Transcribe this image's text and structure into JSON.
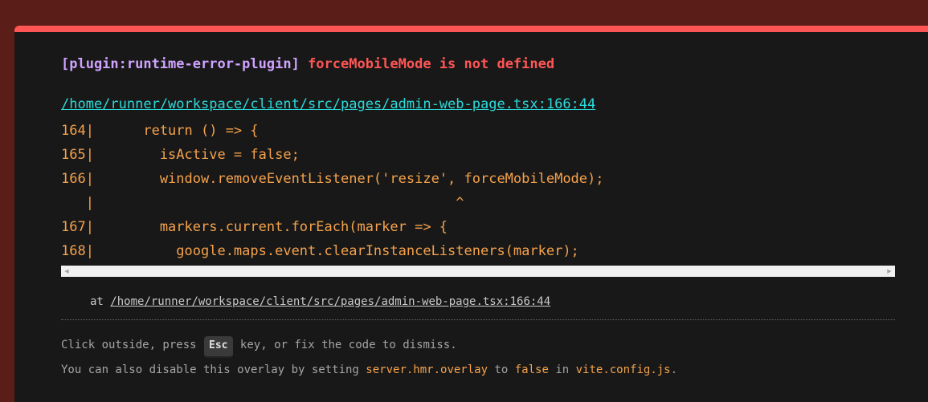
{
  "error": {
    "plugin_label": "[plugin:runtime-error-plugin]",
    "message": "forceMobileMode is not defined",
    "file_link": "/home/runner/workspace/client/src/pages/admin-web-page.tsx:166:44"
  },
  "code_frame": {
    "lines": [
      "164|      return () => {",
      "165|        isActive = false;",
      "166|        window.removeEventListener('resize', forceMobileMode);",
      "   |                                            ^",
      "167|        markers.current.forEach(marker => {",
      "168|          google.maps.event.clearInstanceListeners(marker);"
    ]
  },
  "stack": {
    "prefix": "at ",
    "link": "/home/runner/workspace/client/src/pages/admin-web-page.tsx:166:44"
  },
  "tips": {
    "line1_before": "Click outside, press ",
    "esc_key": "Esc",
    "line1_after": " key, or fix the code to dismiss.",
    "line2_part1": "You can also disable this overlay by setting ",
    "line2_setting": "server.hmr.overlay",
    "line2_part2": " to ",
    "line2_value": "false",
    "line2_part3": " in ",
    "line2_file": "vite.config.js",
    "line2_part4": "."
  },
  "icons": {
    "scroll_left": "scroll-left-arrow-icon",
    "scroll_right": "scroll-right-arrow-icon"
  },
  "colors": {
    "accent": "#ff5555",
    "plugin": "#cfa3ff",
    "link": "#2dd9da",
    "code": "#f5a24c"
  }
}
